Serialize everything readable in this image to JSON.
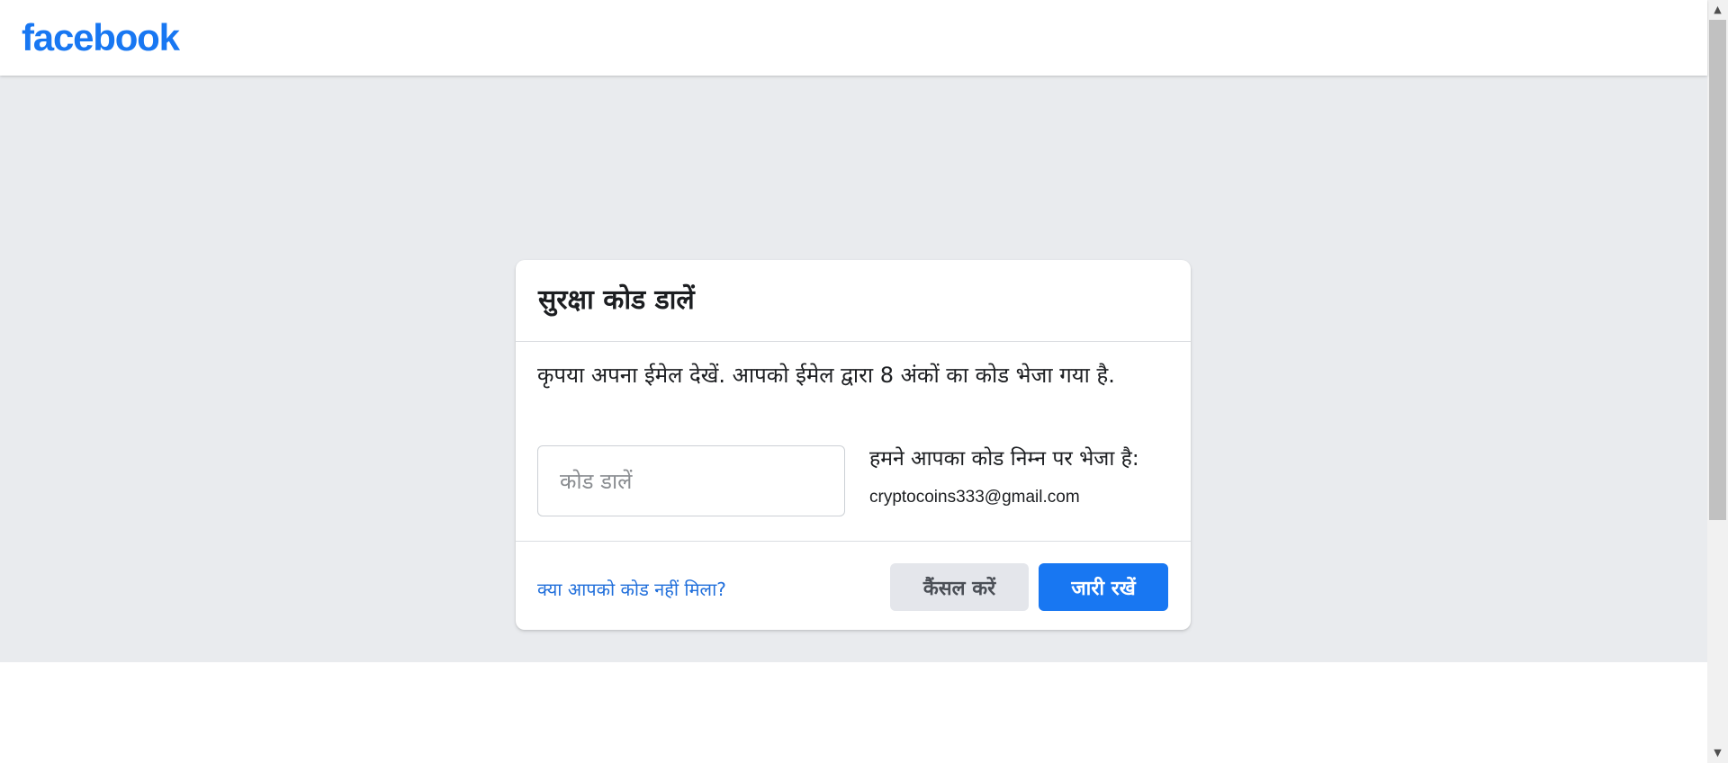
{
  "header": {
    "logo_text": "facebook",
    "brand_color": "#1877f2"
  },
  "dialog": {
    "title": "सुरक्षा कोड डालें",
    "instructions": "कृपया अपना ईमेल देखें. आपको ईमेल द्वारा 8 अंकों का कोड भेजा गया है.",
    "code_input": {
      "placeholder": "कोड डालें",
      "value": ""
    },
    "sent_label": "हमने आपका कोड निम्न पर भेजा है:",
    "sent_email": "cryptocoins333@gmail.com",
    "no_code_link": "क्या आपको कोड नहीं मिला?",
    "cancel_button": "कैंसल करें",
    "continue_button": "जारी रखें"
  },
  "scrollbar": {
    "up_icon": "arrow-up-icon",
    "down_icon": "arrow-down-icon"
  }
}
